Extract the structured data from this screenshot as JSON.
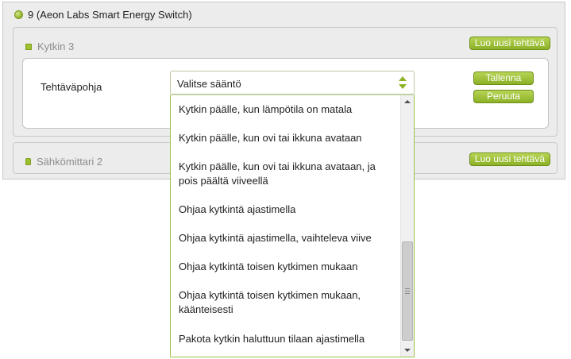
{
  "device": {
    "title": "9 (Aeon Labs Smart Energy Switch)"
  },
  "sections": [
    {
      "label": "Kytkin 3",
      "new_task_label": "Luo uusi tehtävä"
    },
    {
      "label": "Sähkömittari 2",
      "new_task_label": "Luo uusi tehtävä"
    }
  ],
  "task_editor": {
    "template_label": "Tehtäväpohja",
    "select_value": "Valitse sääntö",
    "save_label": "Tallenna",
    "cancel_label": "Peruuta"
  },
  "dropdown": {
    "items": [
      "Kytkin päälle, kun lämpötila on matala",
      "Kytkin päälle, kun ovi tai ikkuna avataan",
      "Kytkin päälle, kun ovi tai ikkuna avataan, ja pois päältä viiveellä",
      "Ohjaa kytkintä ajastimella",
      "Ohjaa kytkintä ajastimella, vaihteleva viive",
      "Ohjaa kytkintä toisen kytkimen mukaan",
      "Ohjaa kytkintä toisen kytkimen mukaan, käänteisesti",
      "Pakota kytkin haluttuun tilaan ajastimella"
    ]
  },
  "colors": {
    "accent": "#8cb127",
    "panel_bg": "#ececec"
  }
}
